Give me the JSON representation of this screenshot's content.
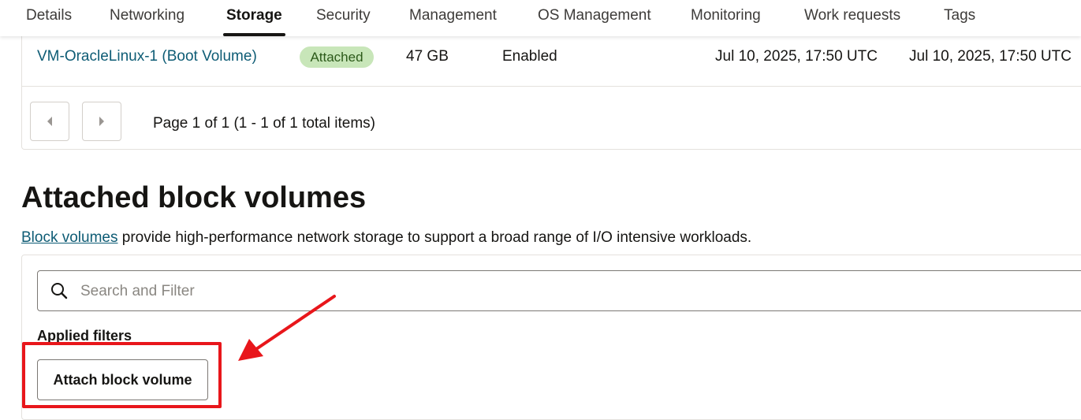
{
  "tabs": [
    {
      "label": "Details"
    },
    {
      "label": "Networking"
    },
    {
      "label": "Storage",
      "active": true
    },
    {
      "label": "Security"
    },
    {
      "label": "Management"
    },
    {
      "label": "OS Management"
    },
    {
      "label": "Monitoring"
    },
    {
      "label": "Work requests"
    },
    {
      "label": "Tags"
    }
  ],
  "boot_volume_row": {
    "name": "VM-OracleLinux-1 (Boot Volume)",
    "state": "Attached",
    "size": "47 GB",
    "encryption": "Enabled",
    "created": "Jul 10, 2025, 17:50 UTC",
    "attached": "Jul 10, 2025, 17:50 UTC"
  },
  "pagination": {
    "prev_icon": "chevron-left-icon",
    "next_icon": "chevron-right-icon",
    "text": "Page 1 of 1 (1 - 1 of 1 total items)"
  },
  "block_volumes": {
    "title": "Attached block volumes",
    "link_text": "Block volumes",
    "description_rest": " provide high-performance network storage to support a broad range of I/O intensive workloads.",
    "search_placeholder": "Search and Filter",
    "search_value": "",
    "applied_filters_label": "Applied filters",
    "attach_button_label": "Attach block volume"
  },
  "colors": {
    "link": "#0e5c75",
    "badge_bg": "#c8e6b9",
    "annotation_red": "#e8161b"
  }
}
